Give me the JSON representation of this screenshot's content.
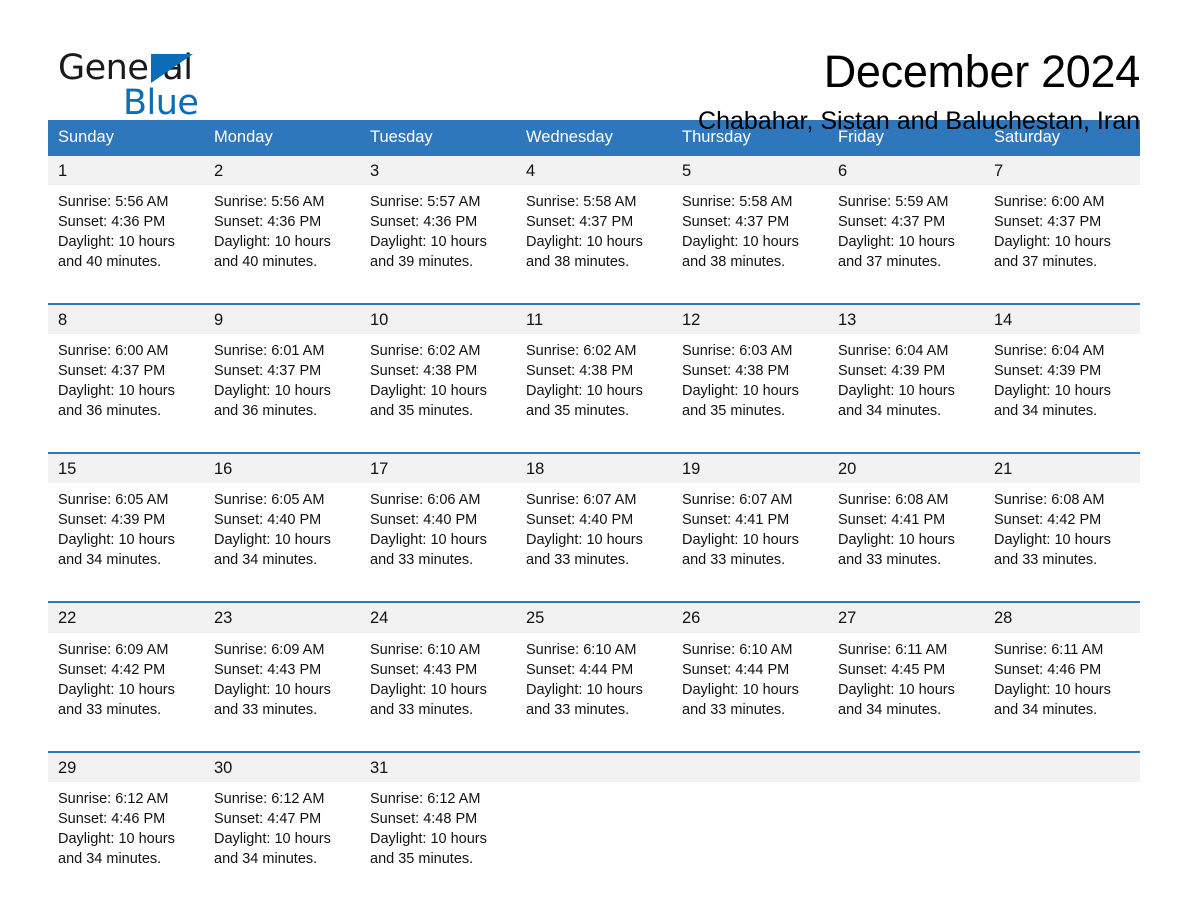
{
  "logo": {
    "text_primary": "General",
    "text_secondary": "Blue",
    "triangle_color": "#0b6cb8"
  },
  "header": {
    "title": "December 2024",
    "location": "Chabahar, Sistan and Baluchestan, Iran"
  },
  "colors": {
    "header_band": "#2e77bc",
    "daynum_background": "#f2f2f2",
    "row_divider": "#2e77bc",
    "text": "#111111",
    "header_text": "#ffffff"
  },
  "calendar": {
    "weekday_headers": [
      "Sunday",
      "Monday",
      "Tuesday",
      "Wednesday",
      "Thursday",
      "Friday",
      "Saturday"
    ],
    "weeks": [
      [
        {
          "day": "1",
          "sunrise": "Sunrise: 5:56 AM",
          "sunset": "Sunset: 4:36 PM",
          "daylight_line1": "Daylight: 10 hours",
          "daylight_line2": "and 40 minutes."
        },
        {
          "day": "2",
          "sunrise": "Sunrise: 5:56 AM",
          "sunset": "Sunset: 4:36 PM",
          "daylight_line1": "Daylight: 10 hours",
          "daylight_line2": "and 40 minutes."
        },
        {
          "day": "3",
          "sunrise": "Sunrise: 5:57 AM",
          "sunset": "Sunset: 4:36 PM",
          "daylight_line1": "Daylight: 10 hours",
          "daylight_line2": "and 39 minutes."
        },
        {
          "day": "4",
          "sunrise": "Sunrise: 5:58 AM",
          "sunset": "Sunset: 4:37 PM",
          "daylight_line1": "Daylight: 10 hours",
          "daylight_line2": "and 38 minutes."
        },
        {
          "day": "5",
          "sunrise": "Sunrise: 5:58 AM",
          "sunset": "Sunset: 4:37 PM",
          "daylight_line1": "Daylight: 10 hours",
          "daylight_line2": "and 38 minutes."
        },
        {
          "day": "6",
          "sunrise": "Sunrise: 5:59 AM",
          "sunset": "Sunset: 4:37 PM",
          "daylight_line1": "Daylight: 10 hours",
          "daylight_line2": "and 37 minutes."
        },
        {
          "day": "7",
          "sunrise": "Sunrise: 6:00 AM",
          "sunset": "Sunset: 4:37 PM",
          "daylight_line1": "Daylight: 10 hours",
          "daylight_line2": "and 37 minutes."
        }
      ],
      [
        {
          "day": "8",
          "sunrise": "Sunrise: 6:00 AM",
          "sunset": "Sunset: 4:37 PM",
          "daylight_line1": "Daylight: 10 hours",
          "daylight_line2": "and 36 minutes."
        },
        {
          "day": "9",
          "sunrise": "Sunrise: 6:01 AM",
          "sunset": "Sunset: 4:37 PM",
          "daylight_line1": "Daylight: 10 hours",
          "daylight_line2": "and 36 minutes."
        },
        {
          "day": "10",
          "sunrise": "Sunrise: 6:02 AM",
          "sunset": "Sunset: 4:38 PM",
          "daylight_line1": "Daylight: 10 hours",
          "daylight_line2": "and 35 minutes."
        },
        {
          "day": "11",
          "sunrise": "Sunrise: 6:02 AM",
          "sunset": "Sunset: 4:38 PM",
          "daylight_line1": "Daylight: 10 hours",
          "daylight_line2": "and 35 minutes."
        },
        {
          "day": "12",
          "sunrise": "Sunrise: 6:03 AM",
          "sunset": "Sunset: 4:38 PM",
          "daylight_line1": "Daylight: 10 hours",
          "daylight_line2": "and 35 minutes."
        },
        {
          "day": "13",
          "sunrise": "Sunrise: 6:04 AM",
          "sunset": "Sunset: 4:39 PM",
          "daylight_line1": "Daylight: 10 hours",
          "daylight_line2": "and 34 minutes."
        },
        {
          "day": "14",
          "sunrise": "Sunrise: 6:04 AM",
          "sunset": "Sunset: 4:39 PM",
          "daylight_line1": "Daylight: 10 hours",
          "daylight_line2": "and 34 minutes."
        }
      ],
      [
        {
          "day": "15",
          "sunrise": "Sunrise: 6:05 AM",
          "sunset": "Sunset: 4:39 PM",
          "daylight_line1": "Daylight: 10 hours",
          "daylight_line2": "and 34 minutes."
        },
        {
          "day": "16",
          "sunrise": "Sunrise: 6:05 AM",
          "sunset": "Sunset: 4:40 PM",
          "daylight_line1": "Daylight: 10 hours",
          "daylight_line2": "and 34 minutes."
        },
        {
          "day": "17",
          "sunrise": "Sunrise: 6:06 AM",
          "sunset": "Sunset: 4:40 PM",
          "daylight_line1": "Daylight: 10 hours",
          "daylight_line2": "and 33 minutes."
        },
        {
          "day": "18",
          "sunrise": "Sunrise: 6:07 AM",
          "sunset": "Sunset: 4:40 PM",
          "daylight_line1": "Daylight: 10 hours",
          "daylight_line2": "and 33 minutes."
        },
        {
          "day": "19",
          "sunrise": "Sunrise: 6:07 AM",
          "sunset": "Sunset: 4:41 PM",
          "daylight_line1": "Daylight: 10 hours",
          "daylight_line2": "and 33 minutes."
        },
        {
          "day": "20",
          "sunrise": "Sunrise: 6:08 AM",
          "sunset": "Sunset: 4:41 PM",
          "daylight_line1": "Daylight: 10 hours",
          "daylight_line2": "and 33 minutes."
        },
        {
          "day": "21",
          "sunrise": "Sunrise: 6:08 AM",
          "sunset": "Sunset: 4:42 PM",
          "daylight_line1": "Daylight: 10 hours",
          "daylight_line2": "and 33 minutes."
        }
      ],
      [
        {
          "day": "22",
          "sunrise": "Sunrise: 6:09 AM",
          "sunset": "Sunset: 4:42 PM",
          "daylight_line1": "Daylight: 10 hours",
          "daylight_line2": "and 33 minutes."
        },
        {
          "day": "23",
          "sunrise": "Sunrise: 6:09 AM",
          "sunset": "Sunset: 4:43 PM",
          "daylight_line1": "Daylight: 10 hours",
          "daylight_line2": "and 33 minutes."
        },
        {
          "day": "24",
          "sunrise": "Sunrise: 6:10 AM",
          "sunset": "Sunset: 4:43 PM",
          "daylight_line1": "Daylight: 10 hours",
          "daylight_line2": "and 33 minutes."
        },
        {
          "day": "25",
          "sunrise": "Sunrise: 6:10 AM",
          "sunset": "Sunset: 4:44 PM",
          "daylight_line1": "Daylight: 10 hours",
          "daylight_line2": "and 33 minutes."
        },
        {
          "day": "26",
          "sunrise": "Sunrise: 6:10 AM",
          "sunset": "Sunset: 4:44 PM",
          "daylight_line1": "Daylight: 10 hours",
          "daylight_line2": "and 33 minutes."
        },
        {
          "day": "27",
          "sunrise": "Sunrise: 6:11 AM",
          "sunset": "Sunset: 4:45 PM",
          "daylight_line1": "Daylight: 10 hours",
          "daylight_line2": "and 34 minutes."
        },
        {
          "day": "28",
          "sunrise": "Sunrise: 6:11 AM",
          "sunset": "Sunset: 4:46 PM",
          "daylight_line1": "Daylight: 10 hours",
          "daylight_line2": "and 34 minutes."
        }
      ],
      [
        {
          "day": "29",
          "sunrise": "Sunrise: 6:12 AM",
          "sunset": "Sunset: 4:46 PM",
          "daylight_line1": "Daylight: 10 hours",
          "daylight_line2": "and 34 minutes."
        },
        {
          "day": "30",
          "sunrise": "Sunrise: 6:12 AM",
          "sunset": "Sunset: 4:47 PM",
          "daylight_line1": "Daylight: 10 hours",
          "daylight_line2": "and 34 minutes."
        },
        {
          "day": "31",
          "sunrise": "Sunrise: 6:12 AM",
          "sunset": "Sunset: 4:48 PM",
          "daylight_line1": "Daylight: 10 hours",
          "daylight_line2": "and 35 minutes."
        },
        {
          "day": "",
          "sunrise": "",
          "sunset": "",
          "daylight_line1": "",
          "daylight_line2": ""
        },
        {
          "day": "",
          "sunrise": "",
          "sunset": "",
          "daylight_line1": "",
          "daylight_line2": ""
        },
        {
          "day": "",
          "sunrise": "",
          "sunset": "",
          "daylight_line1": "",
          "daylight_line2": ""
        },
        {
          "day": "",
          "sunrise": "",
          "sunset": "",
          "daylight_line1": "",
          "daylight_line2": ""
        }
      ]
    ]
  }
}
